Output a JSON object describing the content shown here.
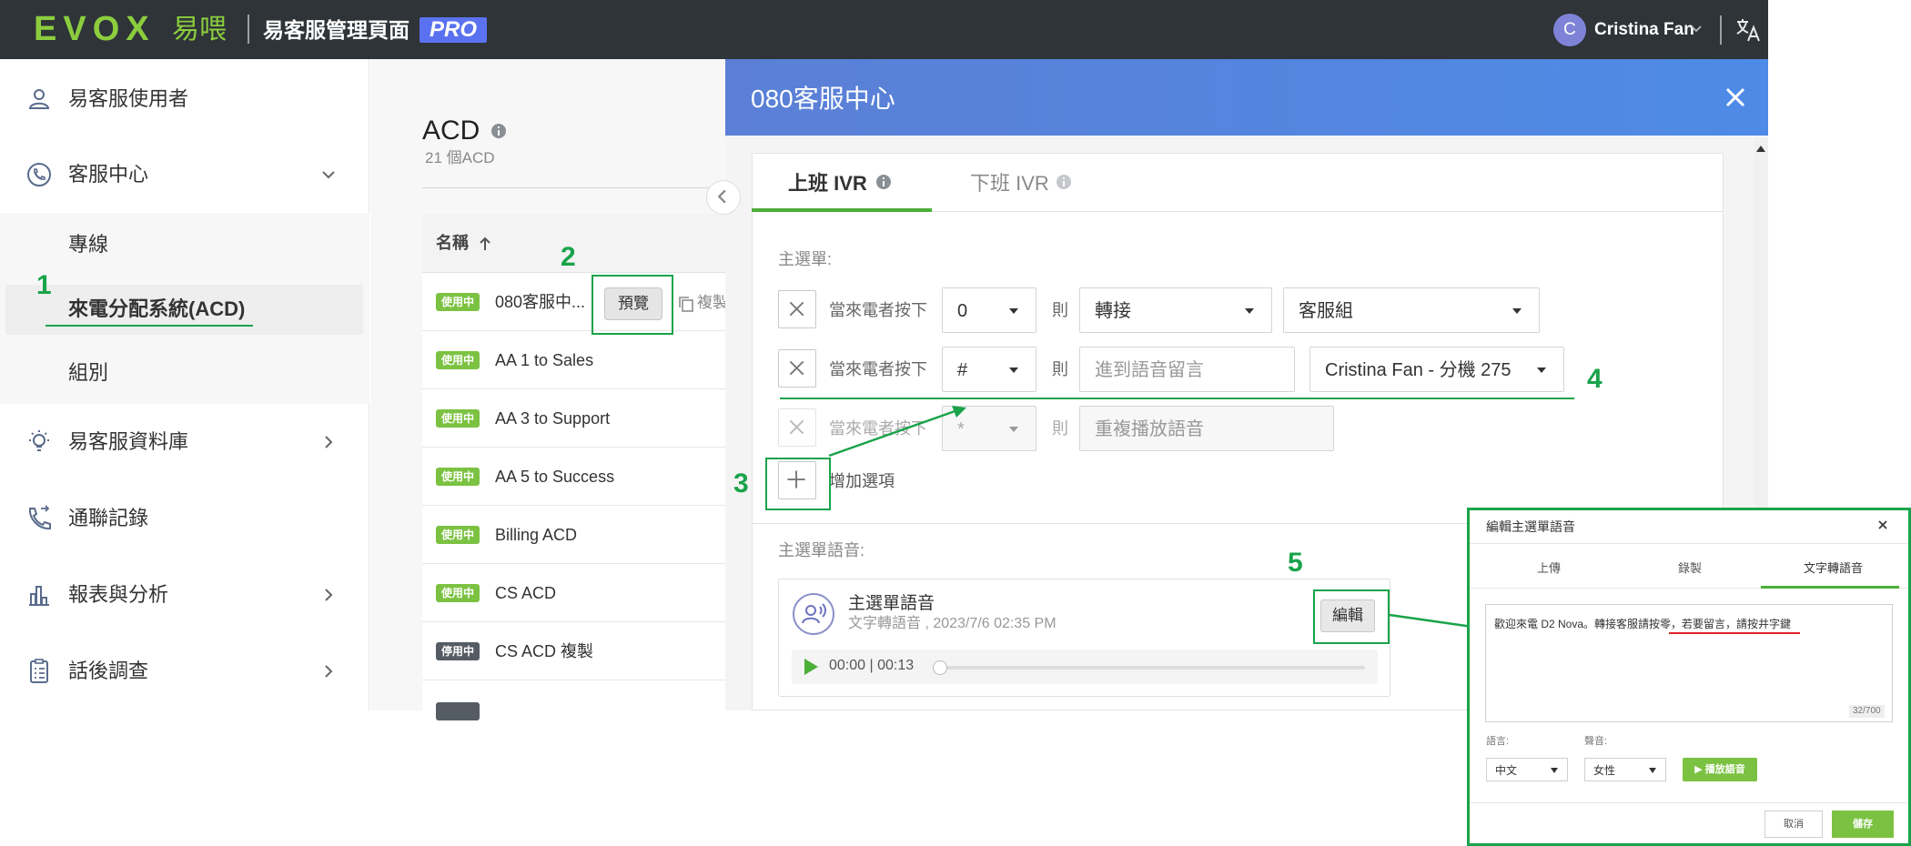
{
  "topbar": {
    "logo_text": "EVOX",
    "logo_cn": "易喂",
    "portal_title": "易客服管理頁面",
    "pro_badge": "PRO",
    "user": {
      "initial": "C",
      "name": "Cristina Fan"
    }
  },
  "sidebar": {
    "items": [
      {
        "label": "易客服使用者",
        "icon": "user-icon"
      },
      {
        "label": "客服中心",
        "icon": "call-center-icon",
        "expanded": true
      },
      {
        "label": "易客服資料庫",
        "icon": "lightbulb-icon"
      },
      {
        "label": "通聯記錄",
        "icon": "phone-log-icon"
      },
      {
        "label": "報表與分析",
        "icon": "chart-icon"
      },
      {
        "label": "話後調查",
        "icon": "survey-icon"
      }
    ],
    "subitems": [
      "專線",
      "來電分配系統(ACD)",
      "組別"
    ],
    "active_subitem": "來電分配系統(ACD)"
  },
  "acd_list": {
    "title": "ACD",
    "count": "21 個ACD",
    "column_name": "名稱",
    "preview_label": "預覽",
    "copy_label": "複製",
    "rows": [
      {
        "status": "使用中",
        "name": "080客服中...",
        "active": true
      },
      {
        "status": "使用中",
        "name": "AA 1 to Sales",
        "active": true
      },
      {
        "status": "使用中",
        "name": "AA 3 to Support",
        "active": true
      },
      {
        "status": "使用中",
        "name": "AA 5 to Success",
        "active": true
      },
      {
        "status": "使用中",
        "name": "Billing ACD",
        "active": true
      },
      {
        "status": "使用中",
        "name": "CS ACD",
        "active": true
      },
      {
        "status": "停用中",
        "name": "CS ACD 複製",
        "active": false
      }
    ]
  },
  "drawer": {
    "title": "080客服中心",
    "tabs": [
      "上班 IVR",
      "下班 IVR"
    ],
    "active_tab": "上班 IVR",
    "main_menu_label": "主選單:",
    "press_text": "當來電者按下",
    "then_text": "則",
    "options": [
      {
        "key": "0",
        "action": "轉接",
        "target": "客服組",
        "target_kind": "select"
      },
      {
        "key": "#",
        "action": "進到語音留言",
        "target": "Cristina Fan - 分機 275",
        "target_kind": "select"
      },
      {
        "key": "*",
        "action": "重複播放語音",
        "disabled": true
      }
    ],
    "add_option_label": "增加選項",
    "voice_section_label": "主選單語音:",
    "voice": {
      "title": "主選單語音",
      "subtitle": "文字轉語音 , 2023/7/6 02:35 PM",
      "edit_label": "編輯",
      "time": "00:00 | 00:13",
      "progress": 0
    }
  },
  "annotations": [
    "1",
    "2",
    "3",
    "4",
    "5"
  ],
  "dialog": {
    "title": "編輯主選單語音",
    "tabs": [
      "上傳",
      "錄製",
      "文字轉語音"
    ],
    "active_tab": "文字轉語音",
    "text": "歡迎來電 D2 Nova。轉接客服請按零，若要留言，請按井字鍵",
    "counter": "32/700",
    "language_label": "語言:",
    "language_value": "中文",
    "voice_label": "聲音:",
    "voice_value": "女性",
    "play_label": "播放語音",
    "cancel_label": "取消",
    "save_label": "儲存"
  },
  "colors": {
    "topbar": "#2e3438",
    "brand_green": "#8ccd3e",
    "accent_green": "#4caf37",
    "annotation_green": "#1aa34a",
    "drawer_header": "#4e8be6",
    "pro_badge": "#5b72f0"
  }
}
